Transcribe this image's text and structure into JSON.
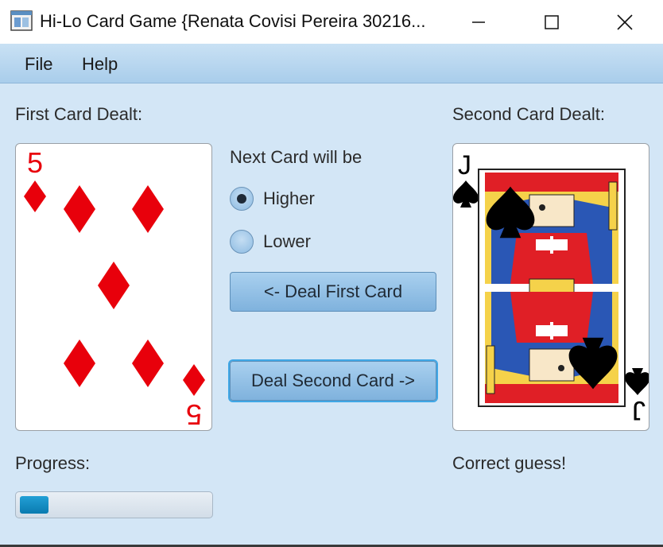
{
  "window": {
    "title": "Hi-Lo Card Game {Renata Covisi Pereira 30216...",
    "controls": [
      "minimize",
      "maximize",
      "close"
    ]
  },
  "menu": {
    "file": "File",
    "help": "Help"
  },
  "first_card": {
    "label": "First Card Dealt:",
    "rank": "5",
    "suit": "diamonds",
    "suit_color": "#e8000b"
  },
  "second_card": {
    "label": "Second Card Dealt:",
    "rank": "J",
    "suit": "spades",
    "suit_color": "#000000"
  },
  "guess": {
    "prompt": "Next Card will be",
    "options": [
      {
        "label": "Higher",
        "selected": true
      },
      {
        "label": "Lower",
        "selected": false
      }
    ]
  },
  "buttons": {
    "deal_first": "<- Deal First Card",
    "deal_second": "Deal Second Card ->"
  },
  "progress": {
    "label": "Progress:",
    "value": 0.15
  },
  "status": {
    "message": "Correct guess!"
  },
  "colors": {
    "background": "#d3e6f6",
    "accent": "#0a7bb0"
  }
}
